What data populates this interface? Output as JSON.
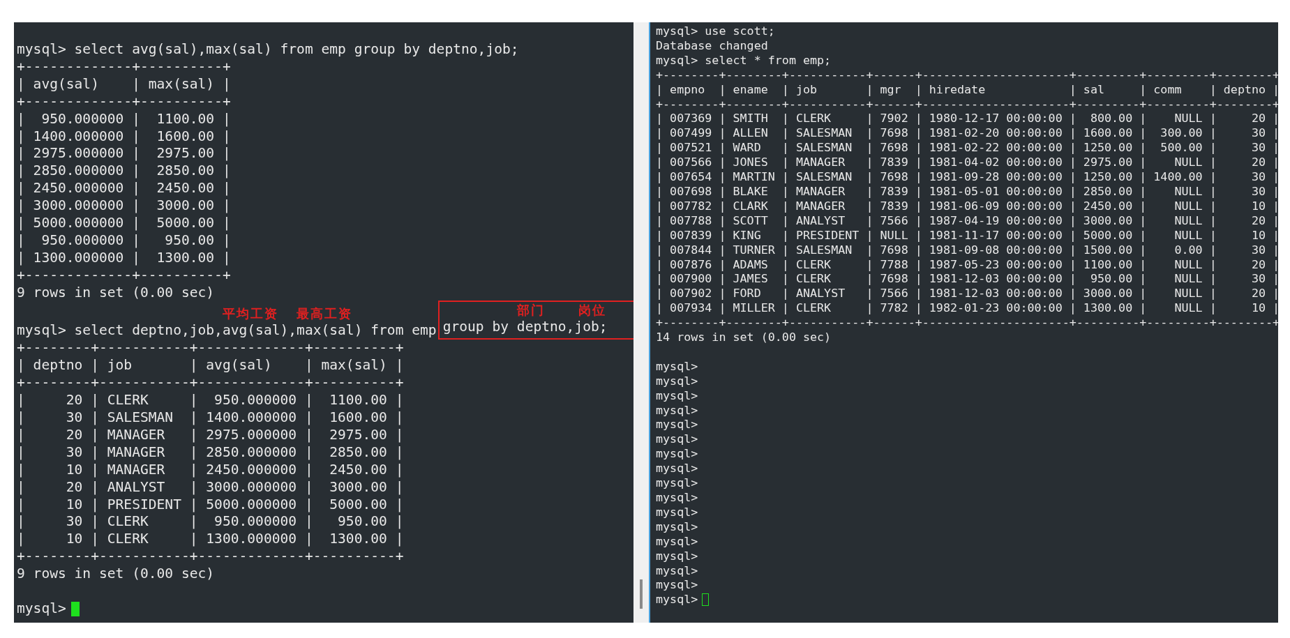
{
  "left_terminal": {
    "lines": [
      {
        "kind": "text",
        "text": "mysql> select avg(sal),max(sal) from emp group by deptno,job;"
      },
      {
        "kind": "text",
        "text": "+-------------+----------+"
      },
      {
        "kind": "text",
        "text": "| avg(sal)    | max(sal) |"
      },
      {
        "kind": "text",
        "text": "+-------------+----------+"
      },
      {
        "kind": "text",
        "text": "|  950.000000 |  1100.00 |"
      },
      {
        "kind": "text",
        "text": "| 1400.000000 |  1600.00 |"
      },
      {
        "kind": "text",
        "text": "| 2975.000000 |  2975.00 |"
      },
      {
        "kind": "text",
        "text": "| 2850.000000 |  2850.00 |"
      },
      {
        "kind": "text",
        "text": "| 2450.000000 |  2450.00 |"
      },
      {
        "kind": "text",
        "text": "| 3000.000000 |  3000.00 |"
      },
      {
        "kind": "text",
        "text": "| 5000.000000 |  5000.00 |"
      },
      {
        "kind": "text",
        "text": "|  950.000000 |   950.00 |"
      },
      {
        "kind": "text",
        "text": "| 1300.000000 |  1300.00 |"
      },
      {
        "kind": "text",
        "text": "+-------------+----------+"
      },
      {
        "kind": "text",
        "text": "9 rows in set (0.00 sec)"
      },
      {
        "kind": "annotated",
        "text": "mysql> select deptno,job,avg(sal),max(sal) from emp",
        "notes": [
          "平均工资",
          "最高工资"
        ],
        "boxed_text": "group by deptno,job;",
        "boxed_notes": [
          "部门",
          "岗位"
        ]
      },
      {
        "kind": "text",
        "text": "+--------+-----------+-------------+----------+"
      },
      {
        "kind": "text",
        "text": "| deptno | job       | avg(sal)    | max(sal) |"
      },
      {
        "kind": "text",
        "text": "+--------+-----------+-------------+----------+"
      },
      {
        "kind": "text",
        "text": "|     20 | CLERK     |  950.000000 |  1100.00 |"
      },
      {
        "kind": "text",
        "text": "|     30 | SALESMAN  | 1400.000000 |  1600.00 |"
      },
      {
        "kind": "text",
        "text": "|     20 | MANAGER   | 2975.000000 |  2975.00 |"
      },
      {
        "kind": "text",
        "text": "|     30 | MANAGER   | 2850.000000 |  2850.00 |"
      },
      {
        "kind": "text",
        "text": "|     10 | MANAGER   | 2450.000000 |  2450.00 |"
      },
      {
        "kind": "text",
        "text": "|     20 | ANALYST   | 3000.000000 |  3000.00 |"
      },
      {
        "kind": "text",
        "text": "|     10 | PRESIDENT | 5000.000000 |  5000.00 |"
      },
      {
        "kind": "text",
        "text": "|     30 | CLERK     |  950.000000 |   950.00 |"
      },
      {
        "kind": "text",
        "text": "|     10 | CLERK     | 1300.000000 |  1300.00 |"
      },
      {
        "kind": "text",
        "text": "+--------+-----------+-------------+----------+"
      },
      {
        "kind": "text",
        "text": "9 rows in set (0.00 sec)"
      },
      {
        "kind": "blank"
      },
      {
        "kind": "prompt",
        "text": "mysql>",
        "focused": true
      }
    ]
  },
  "right_terminal": {
    "lines": [
      {
        "kind": "text",
        "text": "mysql> use scott;"
      },
      {
        "kind": "text",
        "text": "Database changed"
      },
      {
        "kind": "text",
        "text": "mysql> select * from emp;"
      },
      {
        "kind": "text",
        "text": "+--------+--------+-----------+------+---------------------+---------+---------+--------+"
      },
      {
        "kind": "text",
        "text": "| empno  | ename  | job       | mgr  | hiredate            | sal     | comm    | deptno |"
      },
      {
        "kind": "text",
        "text": "+--------+--------+-----------+------+---------------------+---------+---------+--------+"
      },
      {
        "kind": "text",
        "text": "| 007369 | SMITH  | CLERK     | 7902 | 1980-12-17 00:00:00 |  800.00 |    NULL |     20 |"
      },
      {
        "kind": "text",
        "text": "| 007499 | ALLEN  | SALESMAN  | 7698 | 1981-02-20 00:00:00 | 1600.00 |  300.00 |     30 |"
      },
      {
        "kind": "text",
        "text": "| 007521 | WARD   | SALESMAN  | 7698 | 1981-02-22 00:00:00 | 1250.00 |  500.00 |     30 |"
      },
      {
        "kind": "text",
        "text": "| 007566 | JONES  | MANAGER   | 7839 | 1981-04-02 00:00:00 | 2975.00 |    NULL |     20 |"
      },
      {
        "kind": "text",
        "text": "| 007654 | MARTIN | SALESMAN  | 7698 | 1981-09-28 00:00:00 | 1250.00 | 1400.00 |     30 |"
      },
      {
        "kind": "text",
        "text": "| 007698 | BLAKE  | MANAGER   | 7839 | 1981-05-01 00:00:00 | 2850.00 |    NULL |     30 |"
      },
      {
        "kind": "text",
        "text": "| 007782 | CLARK  | MANAGER   | 7839 | 1981-06-09 00:00:00 | 2450.00 |    NULL |     10 |"
      },
      {
        "kind": "text",
        "text": "| 007788 | SCOTT  | ANALYST   | 7566 | 1987-04-19 00:00:00 | 3000.00 |    NULL |     20 |"
      },
      {
        "kind": "text",
        "text": "| 007839 | KING   | PRESIDENT | NULL | 1981-11-17 00:00:00 | 5000.00 |    NULL |     10 |"
      },
      {
        "kind": "text",
        "text": "| 007844 | TURNER | SALESMAN  | 7698 | 1981-09-08 00:00:00 | 1500.00 |    0.00 |     30 |"
      },
      {
        "kind": "text",
        "text": "| 007876 | ADAMS  | CLERK     | 7788 | 1987-05-23 00:00:00 | 1100.00 |    NULL |     20 |"
      },
      {
        "kind": "text",
        "text": "| 007900 | JAMES  | CLERK     | 7698 | 1981-12-03 00:00:00 |  950.00 |    NULL |     30 |"
      },
      {
        "kind": "text",
        "text": "| 007902 | FORD   | ANALYST   | 7566 | 1981-12-03 00:00:00 | 3000.00 |    NULL |     20 |"
      },
      {
        "kind": "text",
        "text": "| 007934 | MILLER | CLERK     | 7782 | 1982-01-23 00:00:00 | 1300.00 |    NULL |     10 |"
      },
      {
        "kind": "text",
        "text": "+--------+--------+-----------+------+---------------------+---------+---------+--------+"
      },
      {
        "kind": "text",
        "text": "14 rows in set (0.00 sec)"
      },
      {
        "kind": "blank"
      },
      {
        "kind": "text",
        "text": "mysql>"
      },
      {
        "kind": "text",
        "text": "mysql>"
      },
      {
        "kind": "text",
        "text": "mysql>"
      },
      {
        "kind": "text",
        "text": "mysql>"
      },
      {
        "kind": "text",
        "text": "mysql>"
      },
      {
        "kind": "text",
        "text": "mysql>"
      },
      {
        "kind": "text",
        "text": "mysql>"
      },
      {
        "kind": "text",
        "text": "mysql>"
      },
      {
        "kind": "text",
        "text": "mysql>"
      },
      {
        "kind": "text",
        "text": "mysql>"
      },
      {
        "kind": "text",
        "text": "mysql>"
      },
      {
        "kind": "text",
        "text": "mysql>"
      },
      {
        "kind": "text",
        "text": "mysql>"
      },
      {
        "kind": "text",
        "text": "mysql>"
      },
      {
        "kind": "text",
        "text": "mysql>"
      },
      {
        "kind": "text",
        "text": "mysql>"
      },
      {
        "kind": "prompt",
        "text": "mysql>",
        "focused": false
      }
    ]
  }
}
